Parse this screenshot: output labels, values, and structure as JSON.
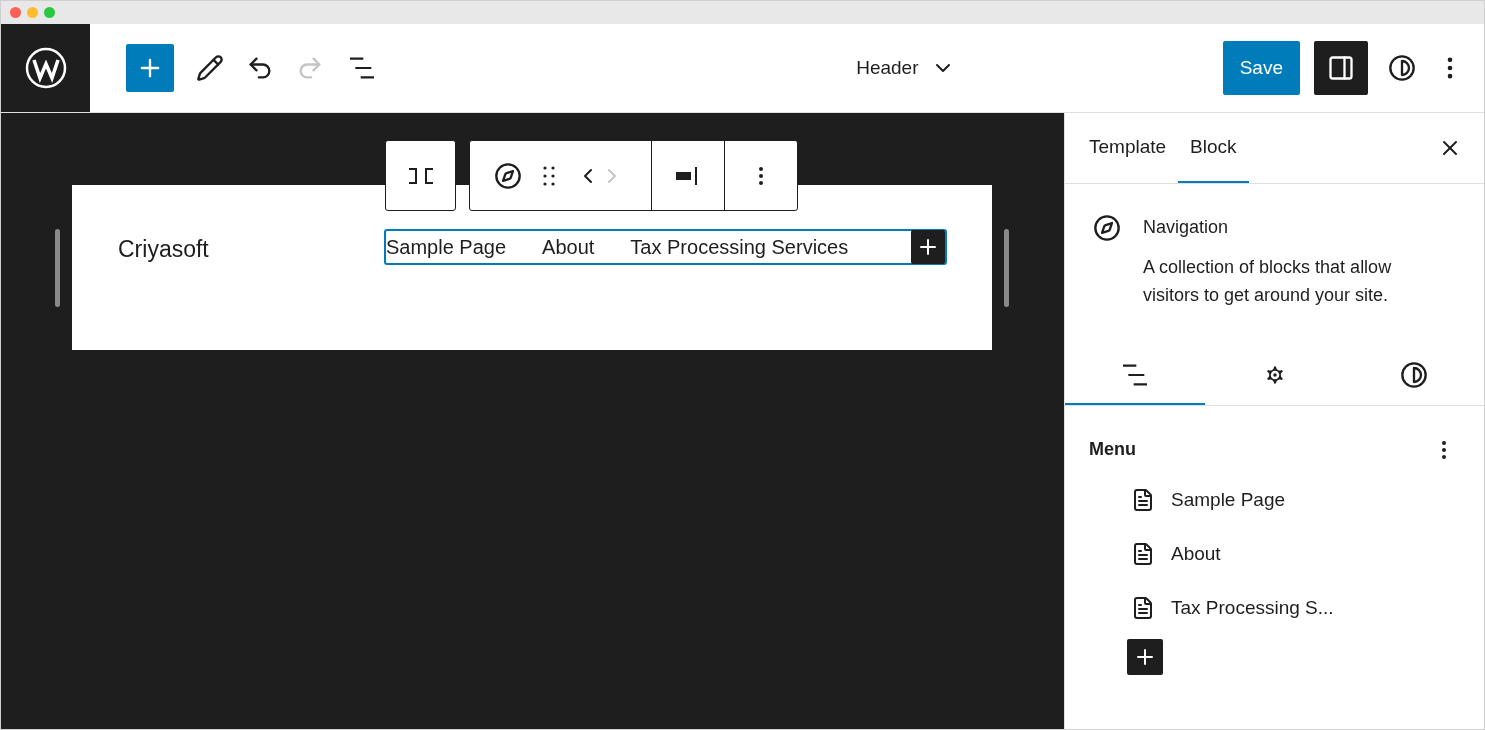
{
  "editor": {
    "title": "Header",
    "redo_disabled": true,
    "sidebar_open": true,
    "save_label": "Save"
  },
  "canvas": {
    "site_title": "Criyasoft",
    "nav_items": [
      "Sample Page",
      "About",
      "Tax Processing Services"
    ]
  },
  "sidebar": {
    "tabs": [
      {
        "label": "Template",
        "selected": false
      },
      {
        "label": "Block",
        "selected": true
      }
    ],
    "block": {
      "name": "Navigation",
      "description": "A collection of blocks that allow visitors to get around your site."
    },
    "inspector_tabs": [
      {
        "kind": "list",
        "selected": true
      },
      {
        "kind": "settings",
        "selected": false
      },
      {
        "kind": "styles",
        "selected": false
      }
    ],
    "menu": {
      "title": "Menu",
      "items": [
        "Sample Page",
        "About",
        "Tax Processing S..."
      ]
    }
  }
}
